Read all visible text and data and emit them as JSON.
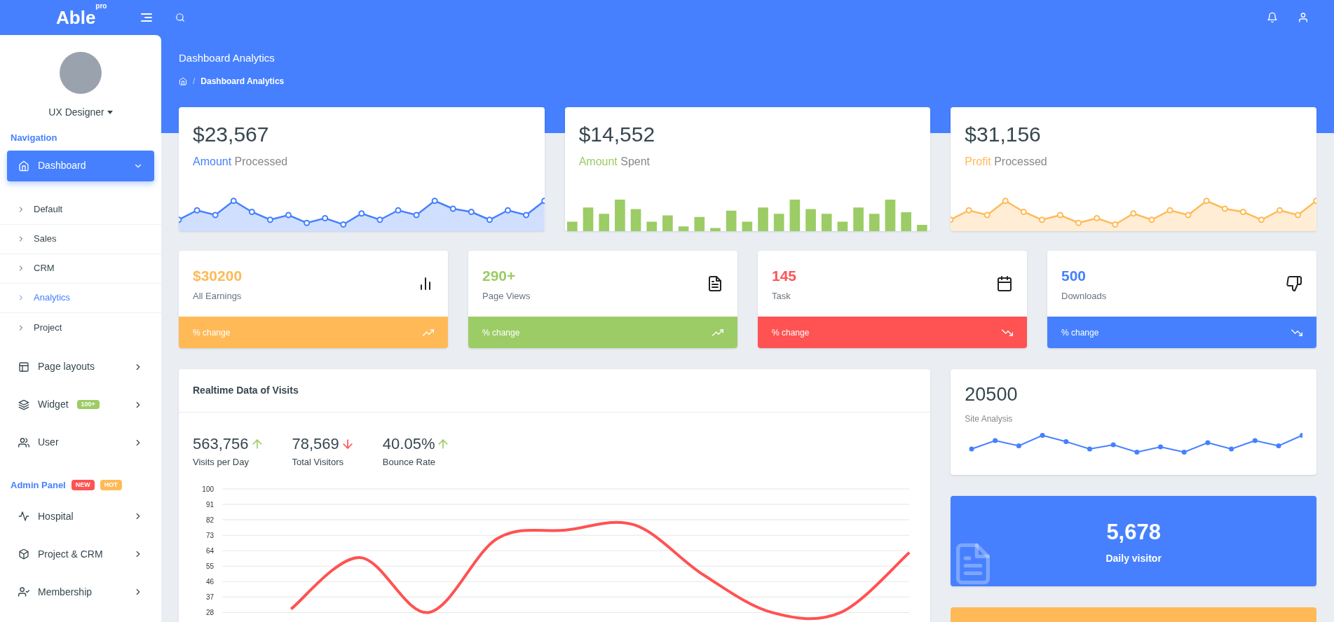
{
  "topbar": {
    "logo": "Able",
    "logo_tag": "pro"
  },
  "profile": {
    "name": "UX Designer"
  },
  "sidebar": {
    "sections": [
      {
        "title": "Navigation",
        "items": [
          {
            "label": "Dashboard",
            "expanded": true,
            "selected": true,
            "children": [
              {
                "label": "Default",
                "selected": false
              },
              {
                "label": "Sales",
                "selected": false
              },
              {
                "label": "CRM",
                "selected": false
              },
              {
                "label": "Analytics",
                "selected": true
              },
              {
                "label": "Project",
                "selected": false
              }
            ]
          },
          {
            "label": "Page layouts",
            "expanded": false,
            "selected": false
          },
          {
            "label": "Widget",
            "expanded": false,
            "selected": false,
            "badge": {
              "text": "100+",
              "color": "#9ccc65"
            }
          },
          {
            "label": "User",
            "expanded": false,
            "selected": false
          }
        ]
      },
      {
        "title": "Admin Panel",
        "badges": [
          {
            "text": "NEW",
            "color": "#ff5252"
          },
          {
            "text": "HOT",
            "color": "#ffba57"
          }
        ],
        "items": [
          {
            "label": "Hospital",
            "expanded": false,
            "selected": false
          },
          {
            "label": "Project & CRM",
            "expanded": false,
            "selected": false
          },
          {
            "label": "Membership",
            "expanded": false,
            "selected": false
          }
        ]
      }
    ]
  },
  "page_header": {
    "title": "Dashboard Analytics",
    "separator": "/",
    "breadcrumb": [
      "Dashboard Analytics"
    ]
  },
  "summary_cards": [
    {
      "value": "$23,567",
      "accent": "Amount",
      "label": "Processed",
      "color": "#4680ff",
      "kind": "area"
    },
    {
      "value": "$14,552",
      "accent": "Amount",
      "label": "Spent",
      "color": "#9ccc65",
      "kind": "bar"
    },
    {
      "value": "$31,156",
      "accent": "Profit",
      "label": "Processed",
      "color": "#ffba57",
      "kind": "area"
    }
  ],
  "stat_cards": [
    {
      "value": "$30200",
      "label": "All Earnings",
      "footer": "% change",
      "color": "#ffba57",
      "rising": true
    },
    {
      "value": "290+",
      "label": "Page Views",
      "footer": "% change",
      "color": "#9ccc65",
      "rising": true
    },
    {
      "value": "145",
      "label": "Task",
      "footer": "% change",
      "color": "#ff5252",
      "rising": false
    },
    {
      "value": "500",
      "label": "Downloads",
      "footer": "% change",
      "color": "#4680ff",
      "rising": false
    }
  ],
  "realtime": {
    "title": "Realtime Data of Visits",
    "metrics": [
      {
        "value": "563,756",
        "rising": true,
        "label": "Visits per Day"
      },
      {
        "value": "78,569",
        "rising": false,
        "label": "Total Visitors"
      },
      {
        "value": "40.05%",
        "rising": true,
        "label": "Bounce Rate"
      }
    ],
    "chart_data": {
      "type": "line",
      "grid": true,
      "ylim": [
        28,
        100
      ],
      "yticks": [
        100,
        91,
        82,
        73,
        64,
        55,
        46,
        37,
        28
      ],
      "values": [
        null,
        30,
        60,
        28,
        71,
        76,
        79,
        50,
        28,
        28,
        63
      ]
    }
  },
  "site_analysis": {
    "value": "20500",
    "label": "Site Analysis"
  },
  "daily_visitor": {
    "value": "5,678",
    "label": "Daily visitor"
  }
}
